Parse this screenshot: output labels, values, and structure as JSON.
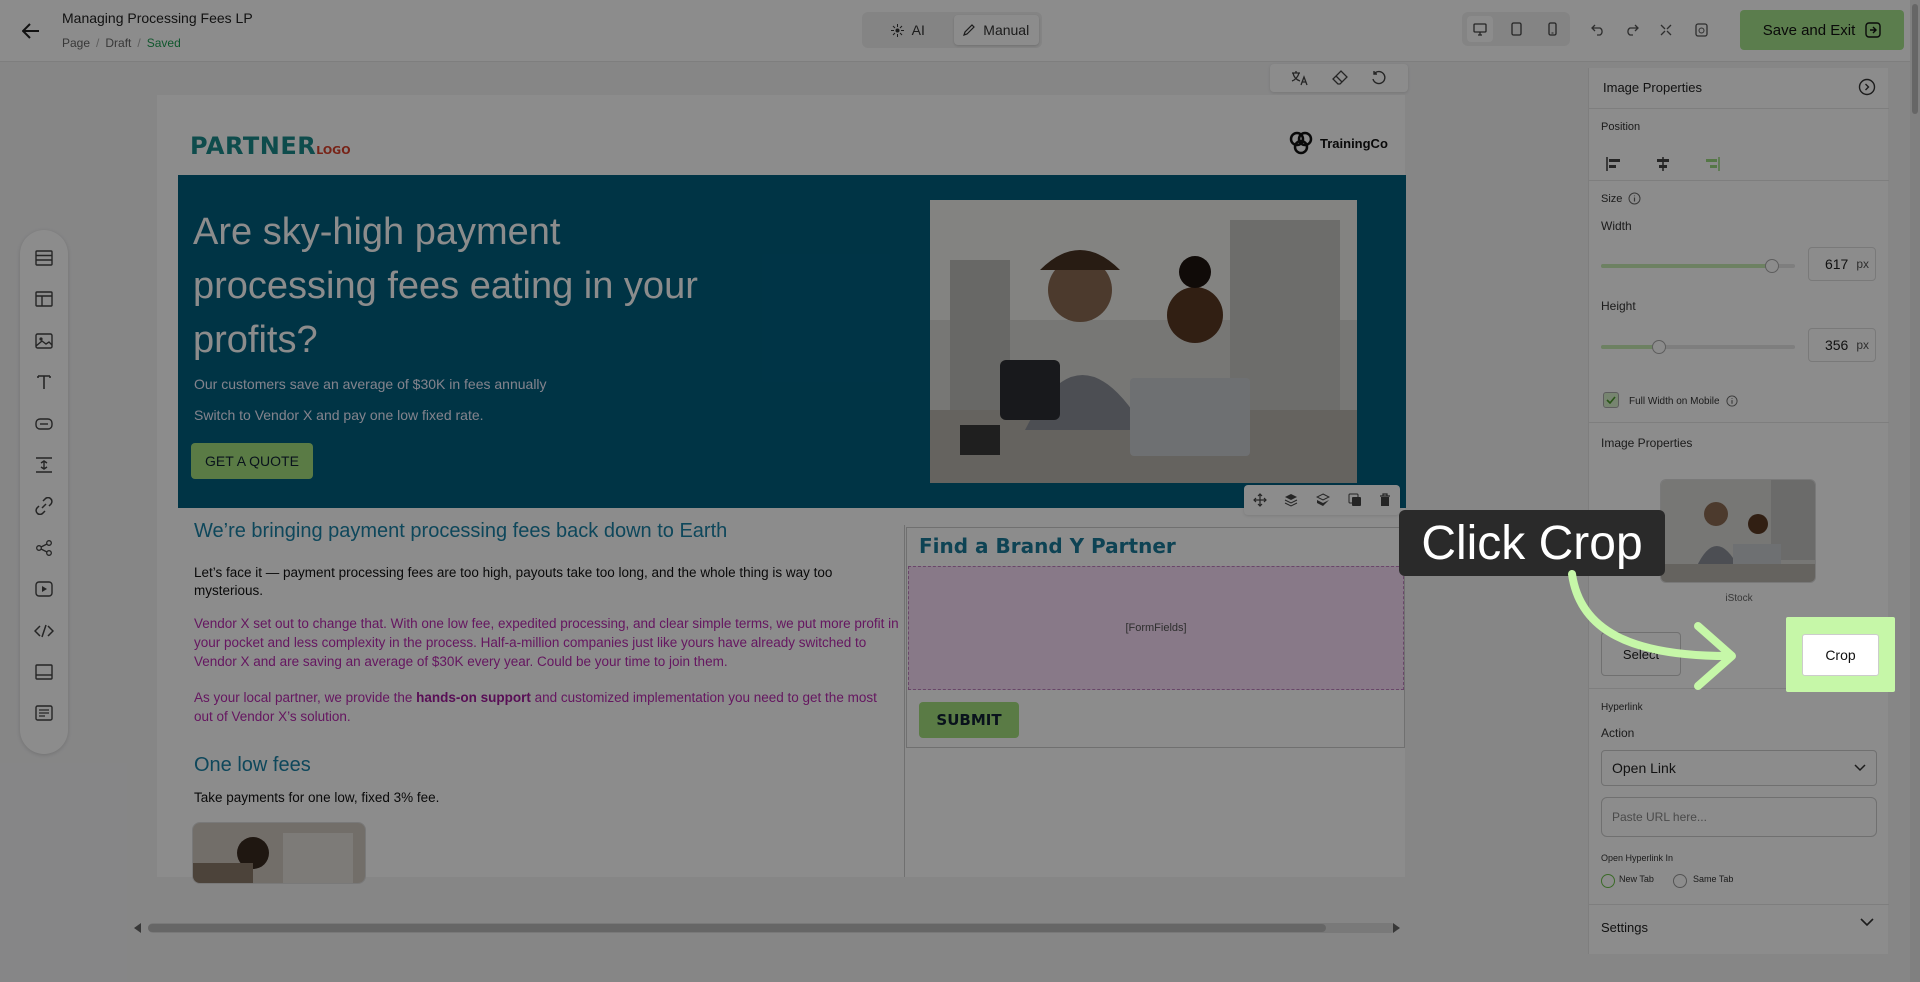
{
  "topbar": {
    "title": "Managing Processing Fees LP",
    "breadcrumb": [
      "Page",
      "Draft"
    ],
    "status": "Saved",
    "modes": [
      "AI",
      "Manual"
    ],
    "save_label": "Save and Exit"
  },
  "canvas": {
    "partner_logo": "PARTNER",
    "partner_logo_sub": "LOGO",
    "trainingco_logo": "TrainingCo",
    "hero": {
      "heading": "Are sky-high payment processing fees eating in your profits?",
      "line1": "Our customers save an average of $30K in fees annually",
      "line2": "Switch to Vendor X and pay one low fixed rate.",
      "cta": "GET A QUOTE"
    },
    "section": {
      "heading": "We’re bringing payment processing fees back down to Earth",
      "p1": "Let’s face it — payment processing fees are too high, payouts take too long, and the whole thing is way too mysterious.",
      "p2": "Vendor X set out to change that. With one low fee, expedited processing, and clear simple terms, we put more profit in your pocket and less complexity in the process. Half-a-million companies just like yours have already switched to Vendor X and are saving an average of $30K every year. Could be your time to join them.",
      "p3_pre": "As your local partner, we provide the ",
      "p3_bold": "hands-on support",
      "p3_post": " and customized implementation you need to get the most out of Vendor X’s solution.",
      "heading2": "One low fees",
      "p4": "Take payments for one low, fixed 3% fee."
    },
    "form": {
      "title": "Find a Brand Y Partner",
      "fields_placeholder": "[FormFields]",
      "submit": "SUBMIT"
    }
  },
  "panel": {
    "title": "Image Properties",
    "position_label": "Position",
    "size_label": "Size",
    "width_label": "Width",
    "width_value": "617",
    "height_label": "Height",
    "height_value": "356",
    "unit": "px",
    "width_slider": 0.88,
    "height_slider": 0.3,
    "full_width_mobile": "Full Width on Mobile",
    "image_props_label": "Image Properties",
    "image_source": "iStock",
    "select_label": "Select",
    "crop_label": "Crop",
    "hyperlink_label": "Hyperlink",
    "action_label": "Action",
    "action_value": "Open Link",
    "url_placeholder": "Paste URL here...",
    "open_in_label": "Open Hyperlink In",
    "new_tab": "New Tab",
    "same_tab": "Same Tab",
    "settings_label": "Settings"
  },
  "callout": {
    "text": "Click Crop"
  },
  "colors": {
    "accent_green": "#a7e38c",
    "hero_bg": "#005f7f",
    "heading_blue": "#1b82a6",
    "magenta_text": "#b92ab0",
    "highlight": "#c6f7a8"
  }
}
